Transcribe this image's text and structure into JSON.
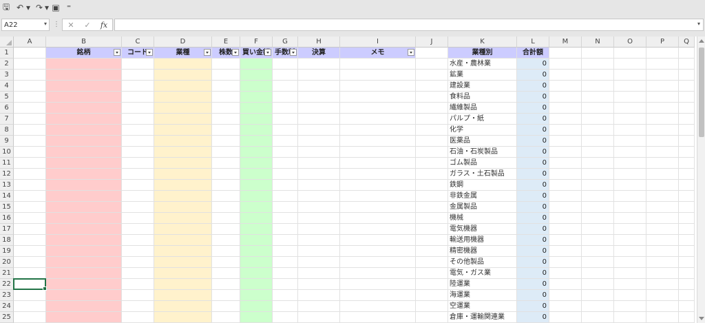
{
  "toolbar": {
    "items": [
      {
        "name": "save-icon",
        "glyph": "🖫"
      },
      {
        "name": "undo-icon",
        "glyph": "↶"
      },
      {
        "name": "undo-dropdown-icon",
        "glyph": "▾"
      },
      {
        "name": "redo-icon",
        "glyph": "↷"
      },
      {
        "name": "redo-dropdown-icon",
        "glyph": "▾"
      },
      {
        "name": "form-icon",
        "glyph": "▣"
      },
      {
        "name": "customize-toolbar-icon",
        "glyph": "⁼"
      }
    ]
  },
  "formula_bar": {
    "name_box": "A22",
    "cancel_icon": "✕",
    "enter_icon": "✓",
    "fx_label": "fx",
    "formula": ""
  },
  "columns": [
    "A",
    "B",
    "C",
    "D",
    "E",
    "F",
    "G",
    "H",
    "I",
    "J",
    "K",
    "L",
    "M",
    "N",
    "O",
    "P",
    "Q"
  ],
  "rows": [
    "1",
    "2",
    "3",
    "4",
    "5",
    "6",
    "7",
    "8",
    "9",
    "10",
    "11",
    "12",
    "13",
    "14",
    "15",
    "16",
    "17",
    "18",
    "19",
    "20",
    "21",
    "22",
    "23",
    "24",
    "25"
  ],
  "table_headers": [
    {
      "col": "B",
      "label": "銘柄",
      "filter": true
    },
    {
      "col": "C",
      "label": "コード",
      "filter": true
    },
    {
      "col": "D",
      "label": "業種",
      "filter": true
    },
    {
      "col": "E",
      "label": "株数",
      "filter": true
    },
    {
      "col": "F",
      "label": "買い金額",
      "filter": true
    },
    {
      "col": "G",
      "label": "手数料",
      "filter": true
    },
    {
      "col": "H",
      "label": "決算",
      "filter": false
    },
    {
      "col": "I",
      "label": "メモ",
      "filter": true
    }
  ],
  "summary_headers": [
    {
      "col": "K",
      "label": "業種別"
    },
    {
      "col": "L",
      "label": "合計額"
    }
  ],
  "sector_rows": [
    {
      "industry": "水産・農林業",
      "total": "0"
    },
    {
      "industry": "鉱業",
      "total": "0"
    },
    {
      "industry": "建設業",
      "total": "0"
    },
    {
      "industry": "食料品",
      "total": "0"
    },
    {
      "industry": "繊維製品",
      "total": "0"
    },
    {
      "industry": "パルプ・紙",
      "total": "0"
    },
    {
      "industry": "化学",
      "total": "0"
    },
    {
      "industry": "医薬品",
      "total": "0"
    },
    {
      "industry": "石油・石炭製品",
      "total": "0"
    },
    {
      "industry": "ゴム製品",
      "total": "0"
    },
    {
      "industry": "ガラス・土石製品",
      "total": "0"
    },
    {
      "industry": "鉄鋼",
      "total": "0"
    },
    {
      "industry": "非鉄金属",
      "total": "0"
    },
    {
      "industry": "金属製品",
      "total": "0"
    },
    {
      "industry": "機械",
      "total": "0"
    },
    {
      "industry": "電気機器",
      "total": "0"
    },
    {
      "industry": "輸送用機器",
      "total": "0"
    },
    {
      "industry": "精密機器",
      "total": "0"
    },
    {
      "industry": "その他製品",
      "total": "0"
    },
    {
      "industry": "電気・ガス業",
      "total": "0"
    },
    {
      "industry": "陸運業",
      "total": "0"
    },
    {
      "industry": "海運業",
      "total": "0"
    },
    {
      "industry": "空運業",
      "total": "0"
    },
    {
      "industry": "倉庫・運輸関連業",
      "total": "0"
    }
  ],
  "colors": {
    "header_fill": "#ccccff",
    "brand_col_fill": "#ffcccc",
    "industry_col_fill": "#fff2cc",
    "buy_amount_col_fill": "#ccffcc",
    "total_col_fill": "#ddebf7",
    "selection": "#217346"
  },
  "selected_cell": "A22"
}
